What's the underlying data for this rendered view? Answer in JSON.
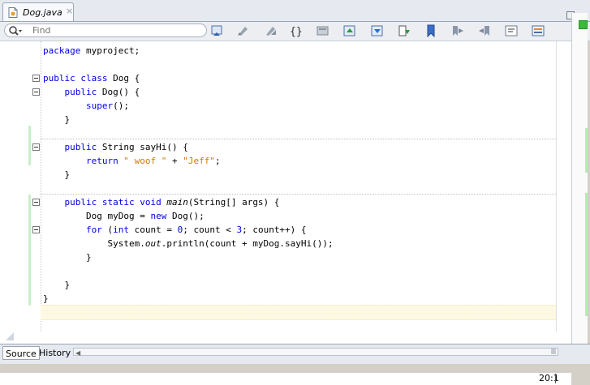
{
  "tab": {
    "title": "Dog.java",
    "close_glyph": "×"
  },
  "search": {
    "placeholder": "Find"
  },
  "toolbar": {
    "icons": [
      "search-icon",
      "last-edit-icon",
      "back-icon",
      "forward-icon",
      "toggle-braces-icon",
      "find-selection-icon",
      "find-previous-icon",
      "find-next-icon",
      "toggle-highlight-icon",
      "toggle-bookmark-icon",
      "previous-bookmark-icon",
      "next-bookmark-icon",
      "shift-left-icon",
      "toggle-comment-icon",
      "macro-icon"
    ]
  },
  "code": {
    "lines": [
      {
        "parts": [
          {
            "t": "package ",
            "c": "kw"
          },
          {
            "t": "myproject;",
            "c": ""
          }
        ]
      },
      {
        "parts": []
      },
      {
        "parts": [
          {
            "t": "public class ",
            "c": "kw"
          },
          {
            "t": "Dog {",
            "c": ""
          }
        ]
      },
      {
        "parts": [
          {
            "t": "    ",
            "c": ""
          },
          {
            "t": "public ",
            "c": "kw"
          },
          {
            "t": "Dog() {",
            "c": ""
          }
        ]
      },
      {
        "parts": [
          {
            "t": "        ",
            "c": ""
          },
          {
            "t": "super",
            "c": "kw"
          },
          {
            "t": "();",
            "c": ""
          }
        ]
      },
      {
        "parts": [
          {
            "t": "    }",
            "c": ""
          }
        ]
      },
      {
        "parts": []
      },
      {
        "parts": [
          {
            "t": "    ",
            "c": ""
          },
          {
            "t": "public ",
            "c": "kw"
          },
          {
            "t": "String sayHi() {",
            "c": ""
          }
        ]
      },
      {
        "parts": [
          {
            "t": "        ",
            "c": ""
          },
          {
            "t": "return ",
            "c": "kw"
          },
          {
            "t": "\" woof \"",
            "c": "str"
          },
          {
            "t": " + ",
            "c": ""
          },
          {
            "t": "\"Jeff\"",
            "c": "str"
          },
          {
            "t": ";",
            "c": ""
          }
        ]
      },
      {
        "parts": [
          {
            "t": "    }",
            "c": ""
          }
        ]
      },
      {
        "parts": []
      },
      {
        "parts": [
          {
            "t": "    ",
            "c": ""
          },
          {
            "t": "public static void ",
            "c": "kw"
          },
          {
            "t": "main",
            "c": "it"
          },
          {
            "t": "(String[] args) {",
            "c": ""
          }
        ]
      },
      {
        "parts": [
          {
            "t": "        Dog myDog = ",
            "c": ""
          },
          {
            "t": "new ",
            "c": "kw"
          },
          {
            "t": "Dog();",
            "c": ""
          }
        ]
      },
      {
        "parts": [
          {
            "t": "        ",
            "c": ""
          },
          {
            "t": "for ",
            "c": "kw"
          },
          {
            "t": "(",
            "c": ""
          },
          {
            "t": "int ",
            "c": "kw"
          },
          {
            "t": "count = ",
            "c": ""
          },
          {
            "t": "0",
            "c": "kw"
          },
          {
            "t": "; count < ",
            "c": ""
          },
          {
            "t": "3",
            "c": "kw"
          },
          {
            "t": "; count++) {",
            "c": ""
          }
        ]
      },
      {
        "parts": [
          {
            "t": "            System.",
            "c": ""
          },
          {
            "t": "out",
            "c": "it"
          },
          {
            "t": ".println(count + myDog.sayHi());",
            "c": ""
          }
        ]
      },
      {
        "parts": [
          {
            "t": "        }",
            "c": ""
          }
        ]
      },
      {
        "parts": []
      },
      {
        "parts": [
          {
            "t": "    }",
            "c": ""
          }
        ]
      },
      {
        "parts": [
          {
            "t": "}",
            "c": ""
          }
        ]
      }
    ]
  },
  "status": {
    "caret_position": "20:1"
  },
  "bottom_tabs": [
    {
      "label": "Source",
      "active": true
    },
    {
      "label": "History",
      "active": false
    }
  ],
  "colors": {
    "keyword": "#0000e6",
    "string": "#ce7b00",
    "current_line": "#fcf8e2",
    "changed": "#c8f0c8",
    "ok": "#3cb83c"
  }
}
